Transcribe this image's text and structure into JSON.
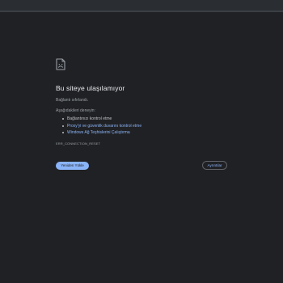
{
  "error": {
    "icon": "broken-page-icon",
    "title": "Bu siteye ulaşılamıyor",
    "subtitle": "Bağlantı sıfırlandı.",
    "try_label": "Aşağıdakileri deneyin:",
    "suggestions": [
      {
        "text": "Bağlantınızı kontrol etme",
        "is_link": false
      },
      {
        "text": "Proxy'yi ve güvenlik duvarını kontrol etme",
        "is_link": true
      },
      {
        "text": "Windows Ağ Teşhislerini Çalıştırma",
        "is_link": true
      }
    ],
    "code": "ERR_CONNECTION_RESET"
  },
  "buttons": {
    "reload": "Yeniden Yükle",
    "details": "Ayrıntılar"
  },
  "colors": {
    "background": "#202124",
    "accent": "#8ab4f8",
    "title_text": "#e8eaed",
    "secondary_text": "#9aa0a6"
  }
}
